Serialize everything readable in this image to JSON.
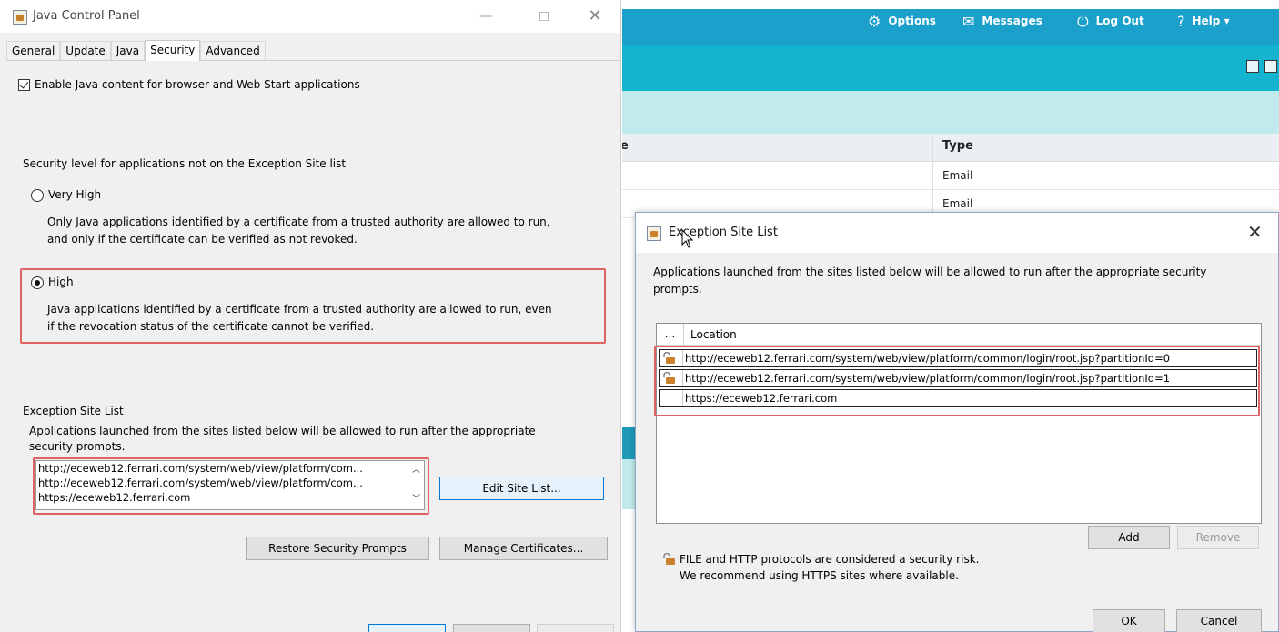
{
  "jcp": {
    "title": "Java Control Panel",
    "tabs": [
      "General",
      "Update",
      "Java",
      "Security",
      "Advanced"
    ],
    "active_tab": "Security",
    "enable_java_label": "Enable Java content for browser and Web Start applications",
    "security_level_label": "Security level for applications not on the Exception Site list",
    "very_high_label": "Very High",
    "very_high_desc_1": "Only Java applications identified by a certificate from a trusted authority are allowed to run,",
    "very_high_desc_2": "and only if the certificate can be verified as not revoked.",
    "high_label": "High",
    "high_desc_1": "Java applications identified by a certificate from a trusted authority are allowed to run, even",
    "high_desc_2": "if the revocation status of the certificate cannot be verified.",
    "exception_heading": "Exception Site List",
    "exception_desc_1": "Applications launched from the sites listed below will be allowed to run after the appropriate",
    "exception_desc_2": "security prompts.",
    "sites": [
      "http://eceweb12.ferrari.com/system/web/view/platform/com...",
      "http://eceweb12.ferrari.com/system/web/view/platform/com...",
      "https://eceweb12.ferrari.com"
    ],
    "edit_site_list_label": "Edit Site List...",
    "restore_prompts_label": "Restore Security Prompts",
    "manage_certs_label": "Manage Certificates..."
  },
  "web": {
    "nav": {
      "options": "Options",
      "messages": "Messages",
      "logout": "Log Out",
      "help": "Help"
    },
    "table": {
      "col_partial": "e",
      "col_type": "Type",
      "rows": [
        "Email",
        "Email"
      ]
    }
  },
  "esl": {
    "title": "Exception Site List",
    "desc_1": "Applications launched from the sites listed below will be allowed to run after the appropriate security",
    "desc_2": "prompts.",
    "col_dots": "...",
    "col_location": "Location",
    "rows": [
      "http://eceweb12.ferrari.com/system/web/view/platform/common/login/root.jsp?partitionId=0",
      "http://eceweb12.ferrari.com/system/web/view/platform/common/login/root.jsp?partitionId=1",
      "https://eceweb12.ferrari.com"
    ],
    "add_label": "Add",
    "remove_label": "Remove",
    "warning_1": "FILE and HTTP protocols are considered a security risk.",
    "warning_2": "We recommend using HTTPS sites where available.",
    "ok_label": "OK",
    "cancel_label": "Cancel"
  },
  "colors": {
    "highlight": "#e06363",
    "web_topbar": "#1ba0cc",
    "web_band": "#14b4d0",
    "web_band_light": "#c1eaec"
  }
}
